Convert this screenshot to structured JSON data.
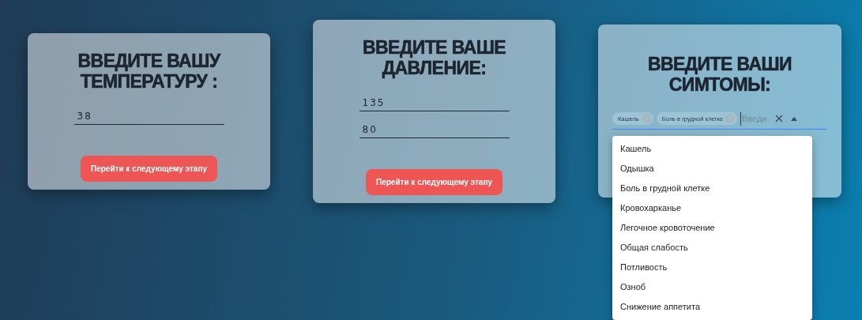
{
  "cards": [
    {
      "kind": "form",
      "title": "ВВЕДИТЕ ВАШУ ТЕМПЕРАТУРУ :",
      "fields": [
        "38"
      ],
      "button": "Перейти к следующему этапу"
    },
    {
      "kind": "form",
      "title": "ВВЕДИТЕ ВАШЕ ДАВЛЕНИЕ:",
      "fields": [
        "135",
        "80"
      ],
      "button": "Перейти к следующему этапу"
    },
    {
      "kind": "multiselect",
      "title": "ВВЕДИТЕ ВАШИ СИМТОМЫ:",
      "chips": [
        "Кашель",
        "Боль в грудной клетке"
      ],
      "placeholder": "Введи",
      "expanded": true,
      "options": [
        "Кашель",
        "Одышка",
        "Боль в грудной клетке",
        "Кровохарканье",
        "Легочное кровоточение",
        "Общая слабость",
        "Потливость",
        "Озноб",
        "Снижение аппетита"
      ]
    }
  ]
}
